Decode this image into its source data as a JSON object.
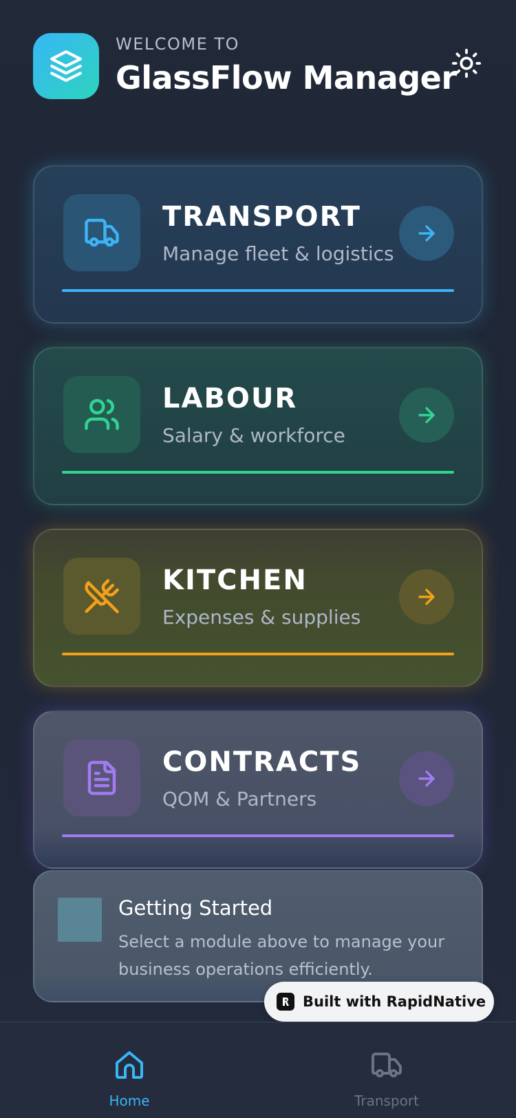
{
  "header": {
    "welcome": "WELCOME TO",
    "title": "GlassFlow Manager",
    "logo_icon": "layers-icon",
    "theme_icon": "sun-icon"
  },
  "modules": [
    {
      "id": "transport",
      "title": "TRANSPORT",
      "subtitle": "Manage fleet & logistics",
      "icon": "truck-icon",
      "accent": "#3cb4f5"
    },
    {
      "id": "labour",
      "title": "LABOUR",
      "subtitle": "Salary & workforce",
      "icon": "users-icon",
      "accent": "#30d493"
    },
    {
      "id": "kitchen",
      "title": "KITCHEN",
      "subtitle": "Expenses & supplies",
      "icon": "utensils-crossed-icon",
      "accent": "#f2a11a"
    },
    {
      "id": "contracts",
      "title": "CONTRACTS",
      "subtitle": "QOM & Partners",
      "icon": "file-text-icon",
      "accent": "#a07cf0"
    }
  ],
  "info": {
    "title": "Getting Started",
    "text": "Select a module above to manage your business operations efficiently."
  },
  "badge": {
    "label": "Built with RapidNative"
  },
  "tabs": [
    {
      "label": "Home",
      "icon": "home-icon",
      "active": true
    },
    {
      "label": "Transport",
      "icon": "truck-icon",
      "active": false
    }
  ],
  "colors": {
    "background": "#212838",
    "primary": "#38b6f5",
    "tab_inactive": "#6b7487"
  }
}
